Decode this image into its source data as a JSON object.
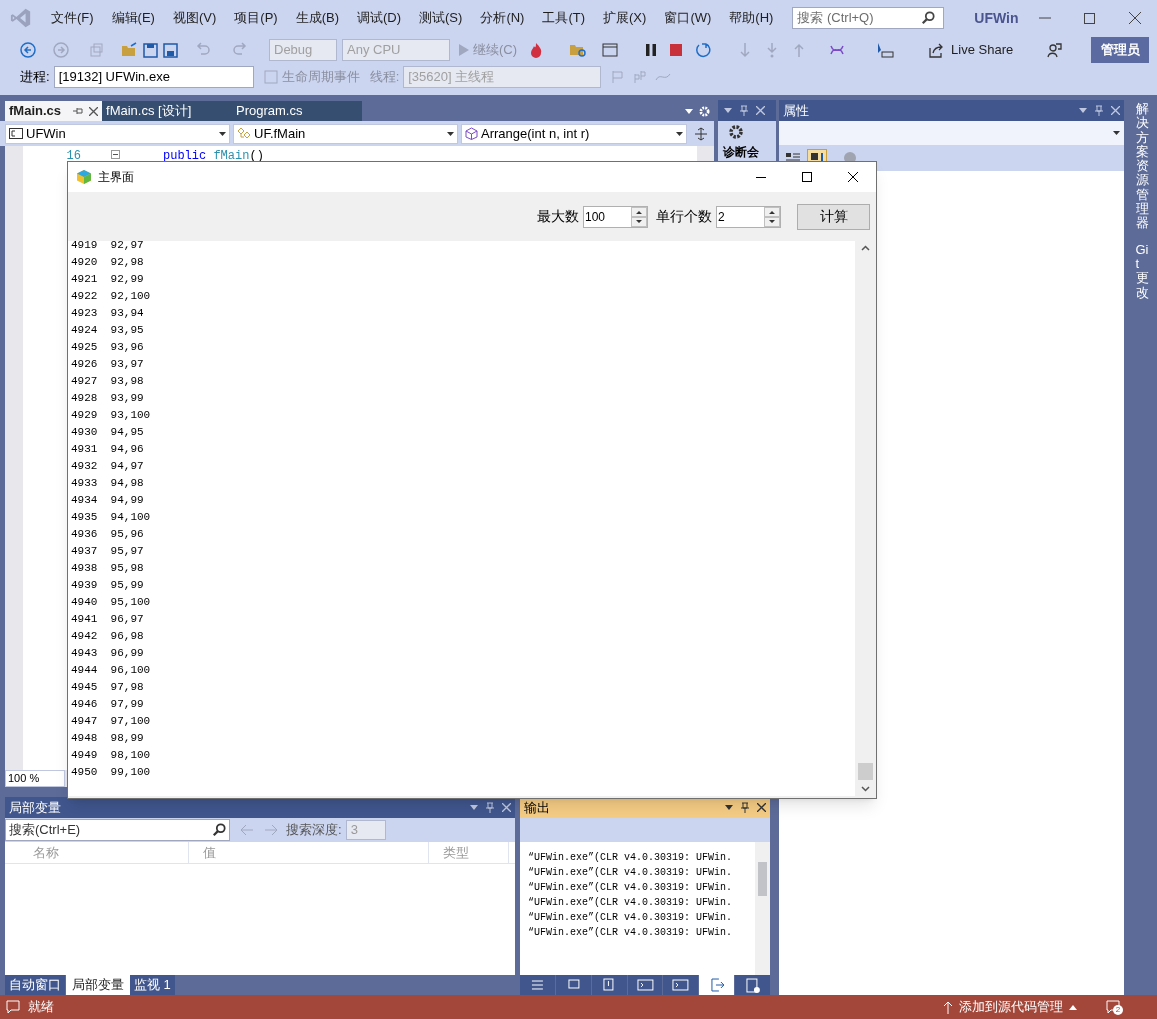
{
  "menu": [
    "文件(F)",
    "编辑(E)",
    "视图(V)",
    "项目(P)",
    "生成(B)",
    "调试(D)",
    "测试(S)",
    "分析(N)",
    "工具(T)",
    "扩展(X)",
    "窗口(W)",
    "帮助(H)"
  ],
  "search": {
    "placeholder": "搜索 (Ctrl+Q)"
  },
  "app_title": "UFWin",
  "toolbar": {
    "config": "Debug",
    "platform": "Any CPU",
    "continue": "继续(C)",
    "live_share": "Live Share",
    "admin": "管理员"
  },
  "debug_location": {
    "process_label": "进程:",
    "process": "[19132] UFWin.exe",
    "lifecycle": "生命周期事件",
    "thread_label": "线程:",
    "thread": "[35620] 主线程"
  },
  "editor": {
    "tabs": [
      {
        "label": "fMain.cs",
        "selected": true
      },
      {
        "label": "fMain.cs [设计]",
        "selected": false
      },
      {
        "label": "Program.cs",
        "selected": false
      }
    ],
    "nav": [
      "UFWin",
      "UF.fMain",
      "Arrange(int n, int r)"
    ],
    "line_number": "16",
    "code_keyword": "public",
    "code_name": "fMain",
    "code_rest": "()",
    "zoom": "100 %"
  },
  "diagnostics": {
    "title": "诊断会"
  },
  "properties": {
    "title": "属性"
  },
  "side_tabs": [
    "解决方案资源管理器",
    "Git 更改"
  ],
  "form": {
    "title": "主界面",
    "max_label": "最大数",
    "max_value": "100",
    "per_row_label": "单行个数",
    "per_row_value": "2",
    "calc_button": "计算",
    "rows": [
      [
        "4919",
        "92,97"
      ],
      [
        "4920",
        "92,98"
      ],
      [
        "4921",
        "92,99"
      ],
      [
        "4922",
        "92,100"
      ],
      [
        "4923",
        "93,94"
      ],
      [
        "4924",
        "93,95"
      ],
      [
        "4925",
        "93,96"
      ],
      [
        "4926",
        "93,97"
      ],
      [
        "4927",
        "93,98"
      ],
      [
        "4928",
        "93,99"
      ],
      [
        "4929",
        "93,100"
      ],
      [
        "4930",
        "94,95"
      ],
      [
        "4931",
        "94,96"
      ],
      [
        "4932",
        "94,97"
      ],
      [
        "4933",
        "94,98"
      ],
      [
        "4934",
        "94,99"
      ],
      [
        "4935",
        "94,100"
      ],
      [
        "4936",
        "95,96"
      ],
      [
        "4937",
        "95,97"
      ],
      [
        "4938",
        "95,98"
      ],
      [
        "4939",
        "95,99"
      ],
      [
        "4940",
        "95,100"
      ],
      [
        "4941",
        "96,97"
      ],
      [
        "4942",
        "96,98"
      ],
      [
        "4943",
        "96,99"
      ],
      [
        "4944",
        "96,100"
      ],
      [
        "4945",
        "97,98"
      ],
      [
        "4946",
        "97,99"
      ],
      [
        "4947",
        "97,100"
      ],
      [
        "4948",
        "98,99"
      ],
      [
        "4949",
        "98,100"
      ],
      [
        "4950",
        "99,100"
      ]
    ]
  },
  "locals": {
    "title": "局部变量",
    "search_placeholder": "搜索(Ctrl+E)",
    "depth_label": "搜索深度:",
    "depth": "3",
    "columns": [
      "名称",
      "值",
      "类型"
    ],
    "tabs": [
      {
        "label": "自动窗口",
        "selected": false
      },
      {
        "label": "局部变量",
        "selected": true
      },
      {
        "label": "监视 1",
        "selected": false
      }
    ]
  },
  "output": {
    "title": "输出",
    "lines": [
      "“UFWin.exe”(CLR v4.0.30319: UFWin.",
      "“UFWin.exe”(CLR v4.0.30319: UFWin.",
      "“UFWin.exe”(CLR v4.0.30319: UFWin.",
      "“UFWin.exe”(CLR v4.0.30319: UFWin.",
      "“UFWin.exe”(CLR v4.0.30319: UFWin.",
      "“UFWin.exe”(CLR v4.0.30319: UFWin."
    ]
  },
  "status_bar": {
    "text": "就绪",
    "source_control": "添加到源代码管理",
    "notifications": "2"
  }
}
